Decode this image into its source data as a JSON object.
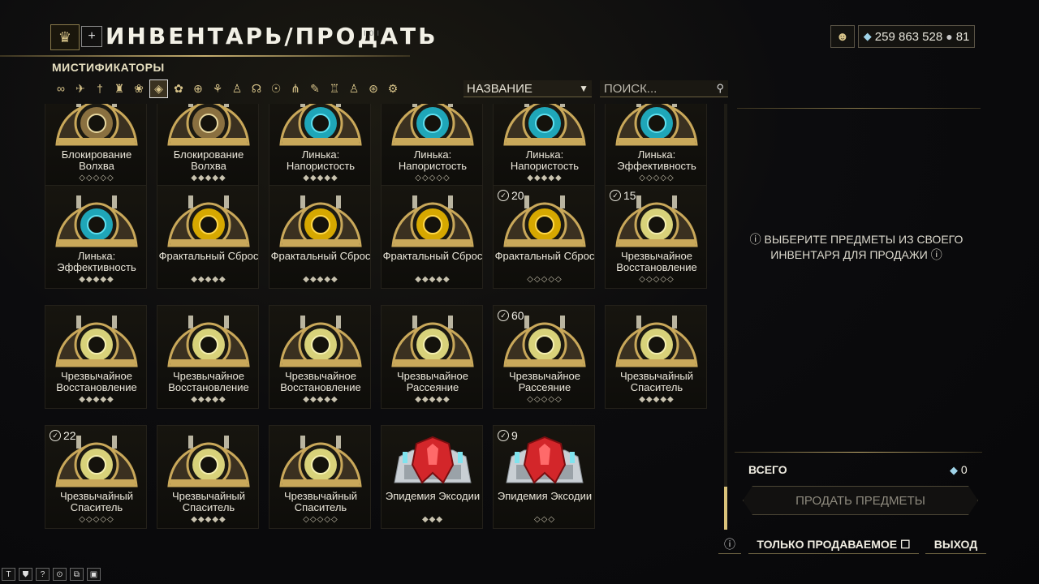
{
  "header": {
    "title": "ИНВЕНТАРЬ/ПРОДАТЬ",
    "sub": "I 0 I",
    "plus": "+"
  },
  "currency": {
    "platinum": "259 863 528",
    "credits": "81"
  },
  "category": "МИСТИФИКАТОРЫ",
  "filters": [
    "∞",
    "✈",
    "†",
    "♜",
    "❀",
    "◈",
    "✿",
    "⊕",
    "⚘",
    "♙",
    "☊",
    "☉",
    "⋔",
    "✎",
    "♖",
    "♙",
    "⊛",
    "⚙"
  ],
  "sort": {
    "label": "НАЗВАНИЕ",
    "arrow": "▼"
  },
  "search": {
    "placeholder": "ПОИСК...",
    "icon": "🔍"
  },
  "items": [
    {
      "name": "Блокирование Волхва",
      "rank": "◇◇◇◇◇",
      "count": "",
      "style": "gold-clamp"
    },
    {
      "name": "Блокирование Волхва",
      "rank": "◆◆◆◆◆",
      "count": "",
      "style": "gold-clamp"
    },
    {
      "name": "Линька: Напористость",
      "rank": "◆◆◆◆◆",
      "count": "",
      "style": "cyan"
    },
    {
      "name": "Линька: Напористость",
      "rank": "◇◇◇◇◇",
      "count": "",
      "style": "cyan"
    },
    {
      "name": "Линька: Напористость",
      "rank": "◆◆◆◆◆",
      "count": "",
      "style": "cyan"
    },
    {
      "name": "Линька: Эффективность",
      "rank": "◇◇◇◇◇",
      "count": "",
      "style": "cyan"
    },
    {
      "name": "Линька: Эффективность",
      "rank": "◆◆◆◆◆",
      "count": "",
      "style": "cyan"
    },
    {
      "name": "Фрактальный Сброс",
      "rank": "◆◆◆◆◆",
      "count": "",
      "style": "yellow"
    },
    {
      "name": "Фрактальный Сброс",
      "rank": "◆◆◆◆◆",
      "count": "",
      "style": "yellow"
    },
    {
      "name": "Фрактальный Сброс",
      "rank": "◆◆◆◆◆",
      "count": "",
      "style": "yellow"
    },
    {
      "name": "Фрактальный Сброс",
      "rank": "◇◇◇◇◇",
      "count": "20",
      "style": "yellow"
    },
    {
      "name": "Чрезвычайное Восстановление",
      "rank": "◇◇◇◇◇",
      "count": "15",
      "style": "pale"
    },
    {
      "name": "Чрезвычайное Восстановление",
      "rank": "◆◆◆◆◆",
      "count": "",
      "style": "pale"
    },
    {
      "name": "Чрезвычайное Восстановление",
      "rank": "◆◆◆◆◆",
      "count": "",
      "style": "pale"
    },
    {
      "name": "Чрезвычайное Восстановление",
      "rank": "◆◆◆◆◆",
      "count": "",
      "style": "pale"
    },
    {
      "name": "Чрезвычайное Рассеяние",
      "rank": "◆◆◆◆◆",
      "count": "",
      "style": "pale"
    },
    {
      "name": "Чрезвычайное Рассеяние",
      "rank": "◇◇◇◇◇",
      "count": "60",
      "style": "pale"
    },
    {
      "name": "Чрезвычайный Спаситель",
      "rank": "◆◆◆◆◆",
      "count": "",
      "style": "pale"
    },
    {
      "name": "Чрезвычайный Спаситель",
      "rank": "◇◇◇◇◇",
      "count": "22",
      "style": "pale"
    },
    {
      "name": "Чрезвычайный Спаситель",
      "rank": "◆◆◆◆◆",
      "count": "",
      "style": "pale"
    },
    {
      "name": "Чрезвычайный Спаситель",
      "rank": "◇◇◇◇◇",
      "count": "",
      "style": "pale"
    },
    {
      "name": "Эпидемия Эксодии",
      "rank": "◆◆◆",
      "count": "",
      "style": "red"
    },
    {
      "name": "Эпидемия Эксодии",
      "rank": "◇◇◇",
      "count": "9",
      "style": "red"
    }
  ],
  "panel": {
    "message": "ⓘ ВЫБЕРИТЕ ПРЕДМЕТЫ ИЗ СВОЕГО ИНВЕНТАРЯ ДЛЯ ПРОДАЖИ ⓘ",
    "total_label": "ВСЕГО",
    "total_value": "0",
    "sell_button": "ПРОДАТЬ ПРЕДМЕТЫ",
    "info": "ⓘ",
    "only_sellable": "ТОЛЬКО ПРОДАВАЕМОЕ ☐",
    "exit": "ВЫХОД"
  },
  "bottom_left": [
    "T",
    "⛊",
    "?",
    "⊙",
    "⧉",
    "▣"
  ]
}
